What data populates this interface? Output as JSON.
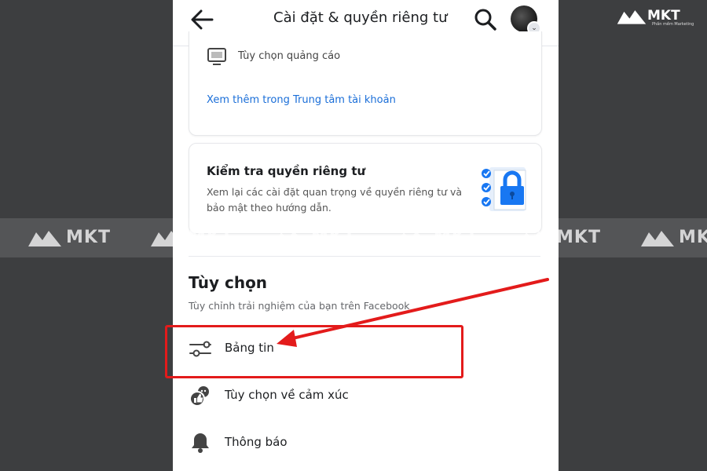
{
  "header": {
    "title": "Cài đặt & quyền riêng tư",
    "back_icon": "arrow-left-icon",
    "search_icon": "search-icon"
  },
  "ads_card": {
    "ad_options_label": "Tùy chọn quảng cáo",
    "account_center_link": "Xem thêm trong Trung tâm tài khoản"
  },
  "privacy_check": {
    "title": "Kiểm tra quyền riêng tư",
    "description": "Xem lại các cài đặt quan trọng về quyền riêng tư và bảo mật theo hướng dẫn."
  },
  "preferences": {
    "title": "Tùy chọn",
    "subtitle": "Tùy chỉnh trải nghiệm của bạn trên Facebook",
    "items": [
      {
        "label": "Bảng tin",
        "icon": "sliders-icon"
      },
      {
        "label": "Tùy chọn về cảm xúc",
        "icon": "reactions-icon"
      },
      {
        "label": "Thông báo",
        "icon": "bell-icon"
      }
    ]
  },
  "branding": {
    "logo_text": "MKT",
    "logo_subtext": "Phần mềm Marketing",
    "watermark_text": "MKT"
  },
  "colors": {
    "link": "#1a6ed8",
    "highlight": "#e31b1b",
    "background": "#3d3e40"
  }
}
